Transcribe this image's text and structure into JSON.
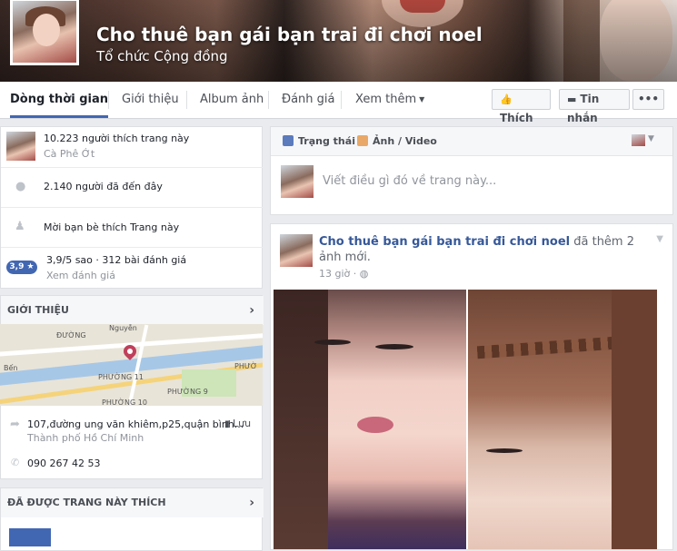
{
  "page": {
    "title": "Cho thuê bạn gái bạn trai đi chơi noel",
    "category": "Tổ chức Cộng đồng"
  },
  "nav": {
    "tabs": [
      "Dòng thời gian",
      "Giới thiệu",
      "Album ảnh",
      "Đánh giá",
      "Xem thêm"
    ],
    "like_button": "Thích",
    "message_button": "Tin nhắn",
    "more_button": "•••"
  },
  "sidebar": {
    "likes_text": "10.223 người thích trang này",
    "likes_sub": "Cà Phê Ớt",
    "checkins_text": "2.140 người đã đến đây",
    "invite_text": "Mời bạn bè thích Trang này",
    "rating_badge": "3,9 ★",
    "rating_text": "3,9/5 sao · 312 bài đánh giá",
    "rating_link": "Xem đánh giá",
    "about_header": "GIỚI THIỆU",
    "address": "107,đường ung văn khiêm,p25,quận bình...",
    "save_label": "Lưu",
    "city": "Thành phố Hồ Chí Minh",
    "phone": "090 267 42 53",
    "liked_header": "ĐÃ ĐƯỢC TRANG NÀY THÍCH",
    "map_labels": [
      "ĐƯỜNG",
      "Nguyễn",
      "Bến",
      "PHƯỜNG 11",
      "PHƯỜNG 9",
      "PHƯỜ",
      "PHƯỜNG 10"
    ]
  },
  "composer": {
    "status_label": "Trạng thái",
    "photo_label": "Ảnh / Video",
    "placeholder": "Viết điều gì đó về trang này..."
  },
  "post": {
    "author": "Cho thuê bạn gái bạn trai đi chơi noel",
    "action": "đã thêm 2 ảnh mới.",
    "time": "13 giờ"
  }
}
